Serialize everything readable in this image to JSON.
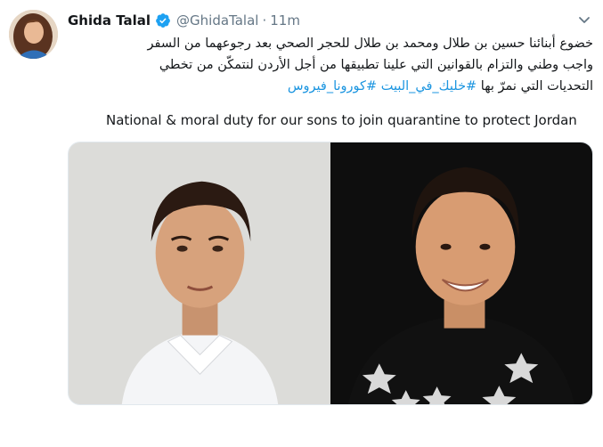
{
  "tweet": {
    "author": {
      "display_name": "Ghida Talal",
      "handle": "@GhidaTalal",
      "verified_icon": "verified-badge-icon",
      "avatar_icon": "avatar"
    },
    "separator": "·",
    "time": "11m",
    "menu_icon": "chevron-down-icon",
    "text_ar": {
      "line1": "خضوع أبنائنا حسين بن طلال ومحمد بن طلال للحجر الصحي بعد رجوعهما من السفر",
      "line2": "واجب وطني والتزام بالقوانين التي علينا تطبيقها من أجل الأردن لنتمكّن من تخطي",
      "line3_text": "التحديات التي نمرّ بها",
      "hashtag1": "#خليك_في_البيت",
      "hashtag2": "#كورونا_فيروس"
    },
    "text_en": "National & moral duty for our sons to join quarantine to protect Jordan",
    "media": {
      "photo_left": "portrait-photo-left",
      "photo_right": "portrait-photo-right"
    }
  },
  "colors": {
    "link": "#1b95e0",
    "verified": "#1da1f2",
    "secondary_text": "#657786",
    "primary_text": "#14171a"
  }
}
